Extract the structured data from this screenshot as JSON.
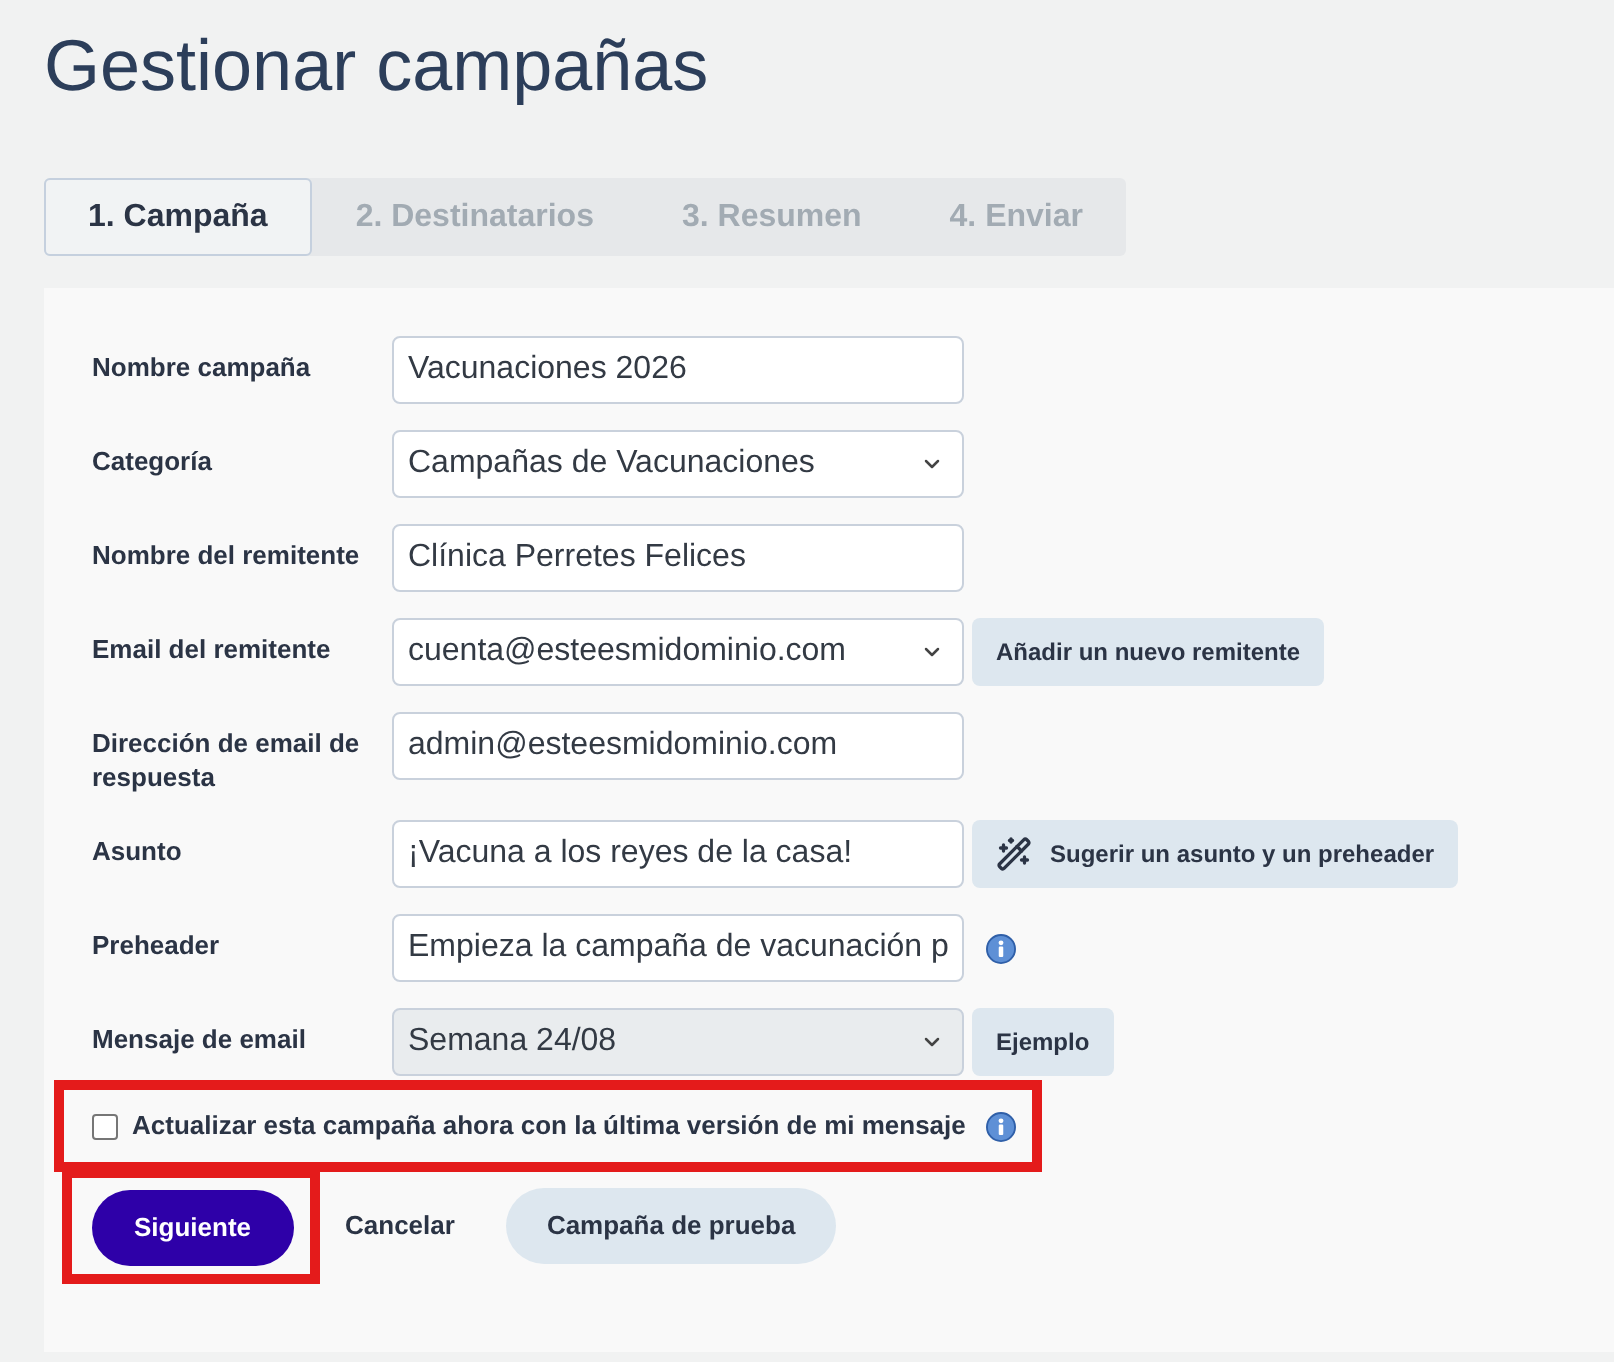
{
  "page": {
    "title": "Gestionar campañas"
  },
  "tabs": [
    {
      "label": "1. Campaña",
      "selected": true
    },
    {
      "label": "2. Destinatarios",
      "selected": false
    },
    {
      "label": "3. Resumen",
      "selected": false
    },
    {
      "label": "4. Enviar",
      "selected": false
    }
  ],
  "fields": [
    {
      "label": "Nombre campaña",
      "kind": "text",
      "value": "Vacunaciones 2026",
      "disabled": false
    },
    {
      "label": "Categoría",
      "kind": "select",
      "value": "Campañas de Vacunaciones",
      "disabled": false
    },
    {
      "label": "Nombre del remitente",
      "kind": "text",
      "value": "Clínica Perretes Felices",
      "disabled": false
    },
    {
      "label": "Email del remitente",
      "kind": "select",
      "value": "cuenta@esteesmidominio.com",
      "disabled": false,
      "button": {
        "label": "Añadir un nuevo remitente",
        "kind": "plain"
      }
    },
    {
      "label": "Dirección de email de respuesta",
      "kind": "text",
      "value": "admin@esteesmidominio.com",
      "disabled": false
    },
    {
      "label": "Asunto",
      "kind": "text",
      "value": "¡Vacuna a los reyes de la casa!",
      "disabled": false,
      "button": {
        "label": "Sugerir un asunto y un preheader",
        "kind": "suggest"
      }
    },
    {
      "label": "Preheader",
      "kind": "text",
      "value": "Empieza la campaña de vacunación p",
      "disabled": false,
      "help": true
    },
    {
      "label": "Mensaje de email",
      "kind": "select",
      "value": "Semana 24/08",
      "disabled": true,
      "button": {
        "label": "Ejemplo",
        "kind": "plain"
      }
    }
  ],
  "checkbox": {
    "label": "Actualizar esta campaña ahora con la última versión de mi mensaje",
    "checked": false,
    "help": true,
    "highlighted": true
  },
  "actions": [
    {
      "label": "Siguiente",
      "kind": "primary",
      "highlighted": true
    },
    {
      "label": "Cancelar",
      "kind": "text",
      "highlighted": false
    },
    {
      "label": "Campaña de prueba",
      "kind": "secondary",
      "highlighted": false
    }
  ]
}
